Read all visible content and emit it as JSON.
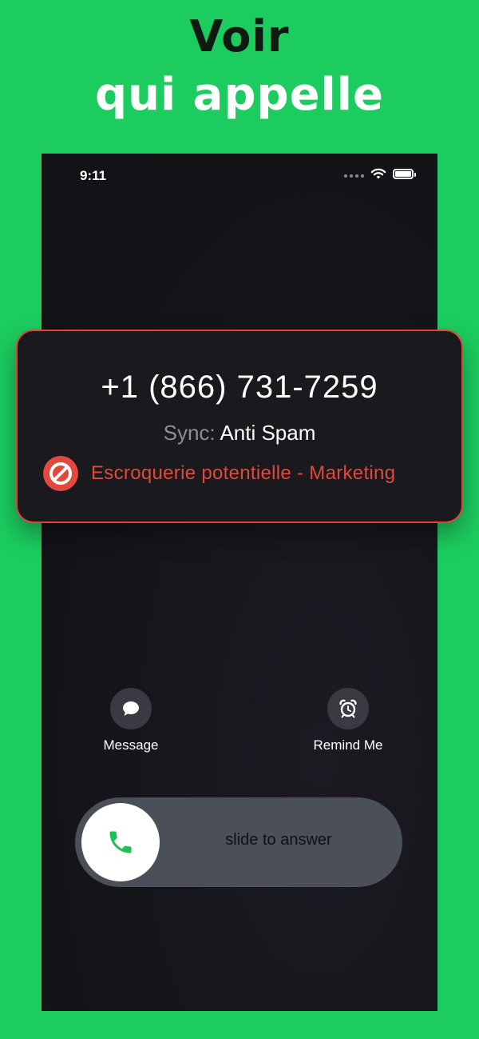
{
  "promo": {
    "headline_line1": "Voir",
    "headline_line2": "qui appelle"
  },
  "status_bar": {
    "time": "9:11",
    "icons": [
      "signal-dots-icon",
      "wifi-icon",
      "battery-icon"
    ]
  },
  "caller": {
    "number": "+1 (866) 731-7259",
    "source_label": "Sync:",
    "source_value": "Anti Spam",
    "warning_icon": "blocked-icon",
    "warning_text": "Escroquerie potentielle - Marketing"
  },
  "actions": [
    {
      "label": "Message",
      "icon": "message-bubble-icon"
    },
    {
      "label": "Remind Me",
      "icon": "alarm-clock-icon"
    }
  ],
  "slider": {
    "text": "slide to answer",
    "icon": "phone-icon"
  },
  "colors": {
    "background_green": "#1ccc5f",
    "warning_red": "#e2493e",
    "phone_green": "#1fbf55",
    "screen_dark": "#141419"
  }
}
